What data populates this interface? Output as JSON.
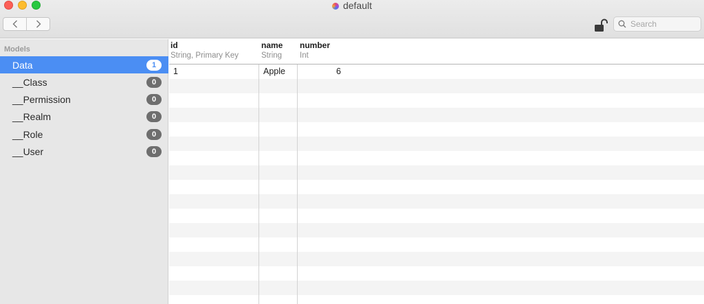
{
  "window": {
    "title": "default"
  },
  "toolbar": {
    "back_icon": "chevron-left-icon",
    "forward_icon": "chevron-right-icon",
    "lock_icon": "unlocked-padlock-icon",
    "search_placeholder": "Search"
  },
  "sidebar": {
    "header": "Models",
    "items": [
      {
        "label": "Data",
        "count": "1",
        "selected": true
      },
      {
        "label": "__Class",
        "count": "0"
      },
      {
        "label": "__Permission",
        "count": "0"
      },
      {
        "label": "__Realm",
        "count": "0"
      },
      {
        "label": "__Role",
        "count": "0"
      },
      {
        "label": "__User",
        "count": "0"
      }
    ]
  },
  "table": {
    "columns": [
      {
        "name": "id",
        "type": "String, Primary Key"
      },
      {
        "name": "name",
        "type": "String"
      },
      {
        "name": "number",
        "type": "Int"
      }
    ],
    "rows": [
      {
        "id": "1",
        "name": "Apple",
        "number": "6"
      }
    ]
  },
  "colors": {
    "selection": "#4b8ef3",
    "badge": "#6e6e6e",
    "stripe": "#f4f4f4"
  }
}
